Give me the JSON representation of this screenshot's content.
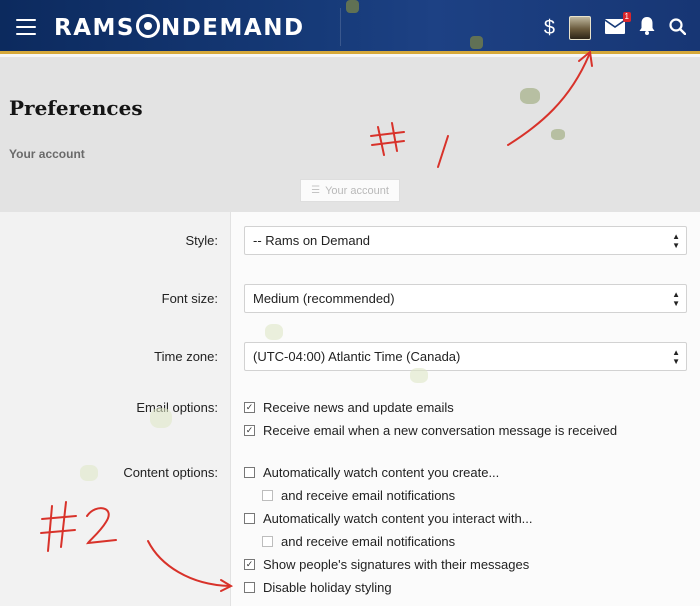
{
  "header": {
    "brand_left": "RAMS",
    "brand_right": "NDEMAND",
    "notification_count": "1",
    "icons": [
      "menu-icon",
      "dollar-icon",
      "avatar",
      "mail-icon",
      "bell-icon",
      "search-icon"
    ]
  },
  "page": {
    "title": "Preferences",
    "breadcrumb": "Your account",
    "tab_label": "Your account"
  },
  "form": {
    "style": {
      "label": "Style:",
      "value": "-- Rams on Demand"
    },
    "font_size": {
      "label": "Font size:",
      "value": "Medium (recommended)"
    },
    "time_zone": {
      "label": "Time zone:",
      "value": "(UTC-04:00) Atlantic Time (Canada)"
    },
    "email_options": {
      "label": "Email options:",
      "items": [
        {
          "label": "Receive news and update emails",
          "checked": true
        },
        {
          "label": "Receive email when a new conversation message is received",
          "checked": true
        }
      ]
    },
    "content_options": {
      "label": "Content options:",
      "items": [
        {
          "label": "Automatically watch content you create...",
          "checked": false
        },
        {
          "label": "and receive email notifications",
          "checked": false,
          "disabled": true
        },
        {
          "label": "Automatically watch content you interact with...",
          "checked": false
        },
        {
          "label": "and receive email notifications",
          "checked": false,
          "disabled": true
        },
        {
          "label": "Show people's signatures with their messages",
          "checked": true
        },
        {
          "label": "Disable holiday styling",
          "checked": false
        }
      ]
    }
  },
  "annotations": {
    "mark_1": "#1",
    "mark_2": "#2",
    "color": "#d8322a"
  },
  "colors": {
    "header": "#163a78",
    "header_accent": "#d6a93a",
    "badge": "#d9262c"
  }
}
